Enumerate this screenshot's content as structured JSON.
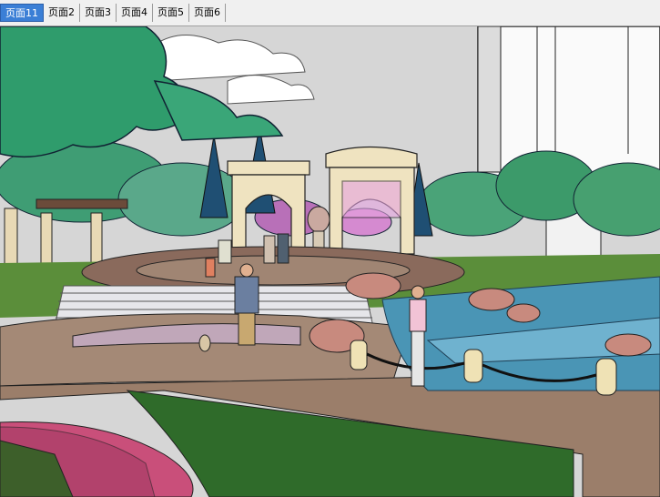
{
  "tabs": [
    {
      "label": "页面11",
      "active": true
    },
    {
      "label": "页面2",
      "active": false
    },
    {
      "label": "页面3",
      "active": false
    },
    {
      "label": "页面4",
      "active": false
    },
    {
      "label": "页面5",
      "active": false
    },
    {
      "label": "页面6",
      "active": false
    }
  ],
  "colors": {
    "active_tab": "#3b7fd6",
    "sky": "#d9d9d9",
    "tree_green": "#2e9e6e",
    "water": "#3f8fb0",
    "paving": "#8a6a5c",
    "flowers": "#c94f7a"
  }
}
